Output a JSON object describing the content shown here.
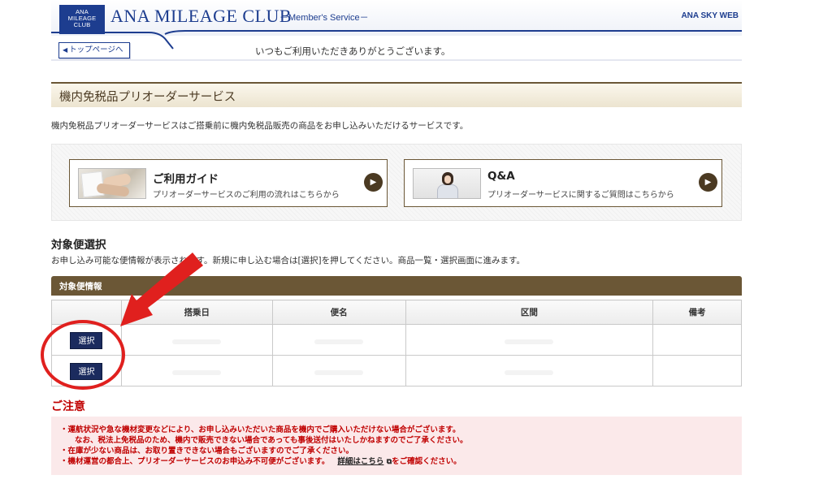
{
  "header": {
    "logo_text": "ANA MILEAGE CLUB",
    "brand": "ANA MILEAGE CLUB",
    "service": "－Member's Service－",
    "right_label": "ANA SKY WEB",
    "top_button": "トップページへ",
    "greeting": "いつもご利用いただきありがとうございます。"
  },
  "page": {
    "title": "機内免税品プリオーダーサービス",
    "intro": "機内免税品プリオーダーサービスはご搭乗前に機内免税品販売の商品をお申し込みいただけるサービスです。"
  },
  "guides": [
    {
      "title": "ご利用ガイド",
      "subtitle": "プリオーダーサービスのご利用の流れはこちらから",
      "image_icon": "hands-paper-image"
    },
    {
      "title": "Q&A",
      "subtitle": "プリオーダーサービスに関するご質問はこちらから",
      "image_icon": "agent-image"
    }
  ],
  "flight_section": {
    "title": "対象便選択",
    "description": "お申し込み可能な便情報が表示されます。新規に申し込む場合は[選択]を押してください。商品一覧・選択画面に進みます。",
    "bar_label": "対象便情報",
    "columns": [
      "",
      "搭乗日",
      "便名",
      "区間",
      "備考"
    ],
    "rows": [
      {
        "select_label": "選択"
      },
      {
        "select_label": "選択"
      }
    ]
  },
  "notice": {
    "title": "ご注意",
    "lines": [
      "・運航状況や急な機材変更などにより、お申し込みいただいた商品を機内でご購入いただけない場合がございます。",
      "なお、税法上免税品のため、機内で販売できない場合であっても事後送付はいたしかねますのでご了承ください。",
      "・在庫が少ない商品は、お取り置きできない場合もございますのでご了承ください。",
      "・機材運営の都合上、プリオーダーサービスのお申込み不可便がございます。"
    ],
    "detail_link": "詳細はこちら",
    "detail_suffix": "をご確認ください。"
  },
  "colors": {
    "brand_blue": "#1d3d8f",
    "brown": "#6b5736",
    "select_button": "#1b2b5e",
    "notice_red": "#c00000",
    "annotation_red": "#e0201e"
  }
}
